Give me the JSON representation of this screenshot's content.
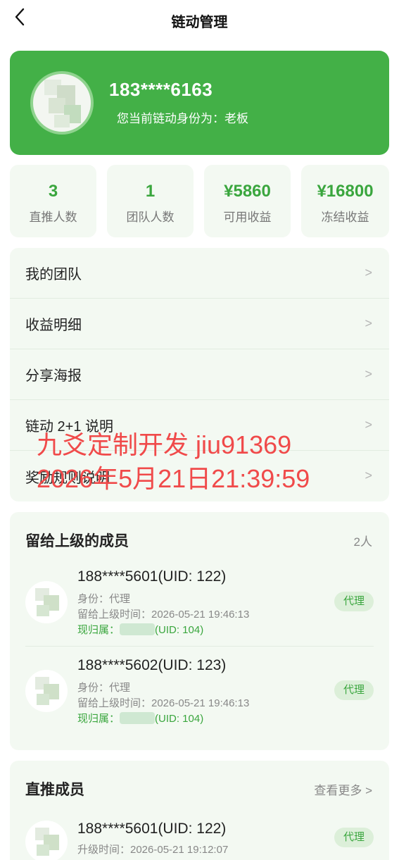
{
  "nav": {
    "title": "链动管理"
  },
  "profile": {
    "phone": "183****6163",
    "identity": "您当前链动身份为：老板"
  },
  "stats": [
    {
      "value": "3",
      "label": "直推人数"
    },
    {
      "value": "1",
      "label": "团队人数"
    },
    {
      "value": "¥5860",
      "label": "可用收益"
    },
    {
      "value": "¥16800",
      "label": "冻结收益"
    }
  ],
  "menu": {
    "chevron": ">",
    "items": [
      {
        "label": "我的团队"
      },
      {
        "label": "收益明细"
      },
      {
        "label": "分享海报"
      },
      {
        "label": "链动 2+1 说明"
      },
      {
        "label": "奖励规则说明"
      }
    ]
  },
  "watermark": {
    "line1": "九爻定制开发 jiu91369",
    "line2": "2026年5月21日21:39:59"
  },
  "left_members": {
    "title": "留给上级的成员",
    "count": "2人",
    "items": [
      {
        "name": "188****5601(UID: 122)",
        "role": "身份：代理",
        "time": "留给上级时间：2026-05-21 19:46:13",
        "owner_prefix": "现归属：",
        "owner_uid": "(UID: 104)",
        "badge": "代理"
      },
      {
        "name": "188****5602(UID: 123)",
        "role": "身份：代理",
        "time": "留给上级时间：2026-05-21 19:46:13",
        "owner_prefix": "现归属：",
        "owner_uid": "(UID: 104)",
        "badge": "代理"
      }
    ]
  },
  "direct_members": {
    "title": "直推成员",
    "more": "查看更多 >",
    "items": [
      {
        "name": "188****5601(UID: 122)",
        "time": "升级时间：2026-05-21 19:12:07",
        "badge": "代理"
      }
    ]
  },
  "colors": {
    "brand": "#43b047",
    "accent_text": "#3aa63e",
    "card_bg": "#f3f9f2",
    "watermark": "#f04a4a"
  }
}
